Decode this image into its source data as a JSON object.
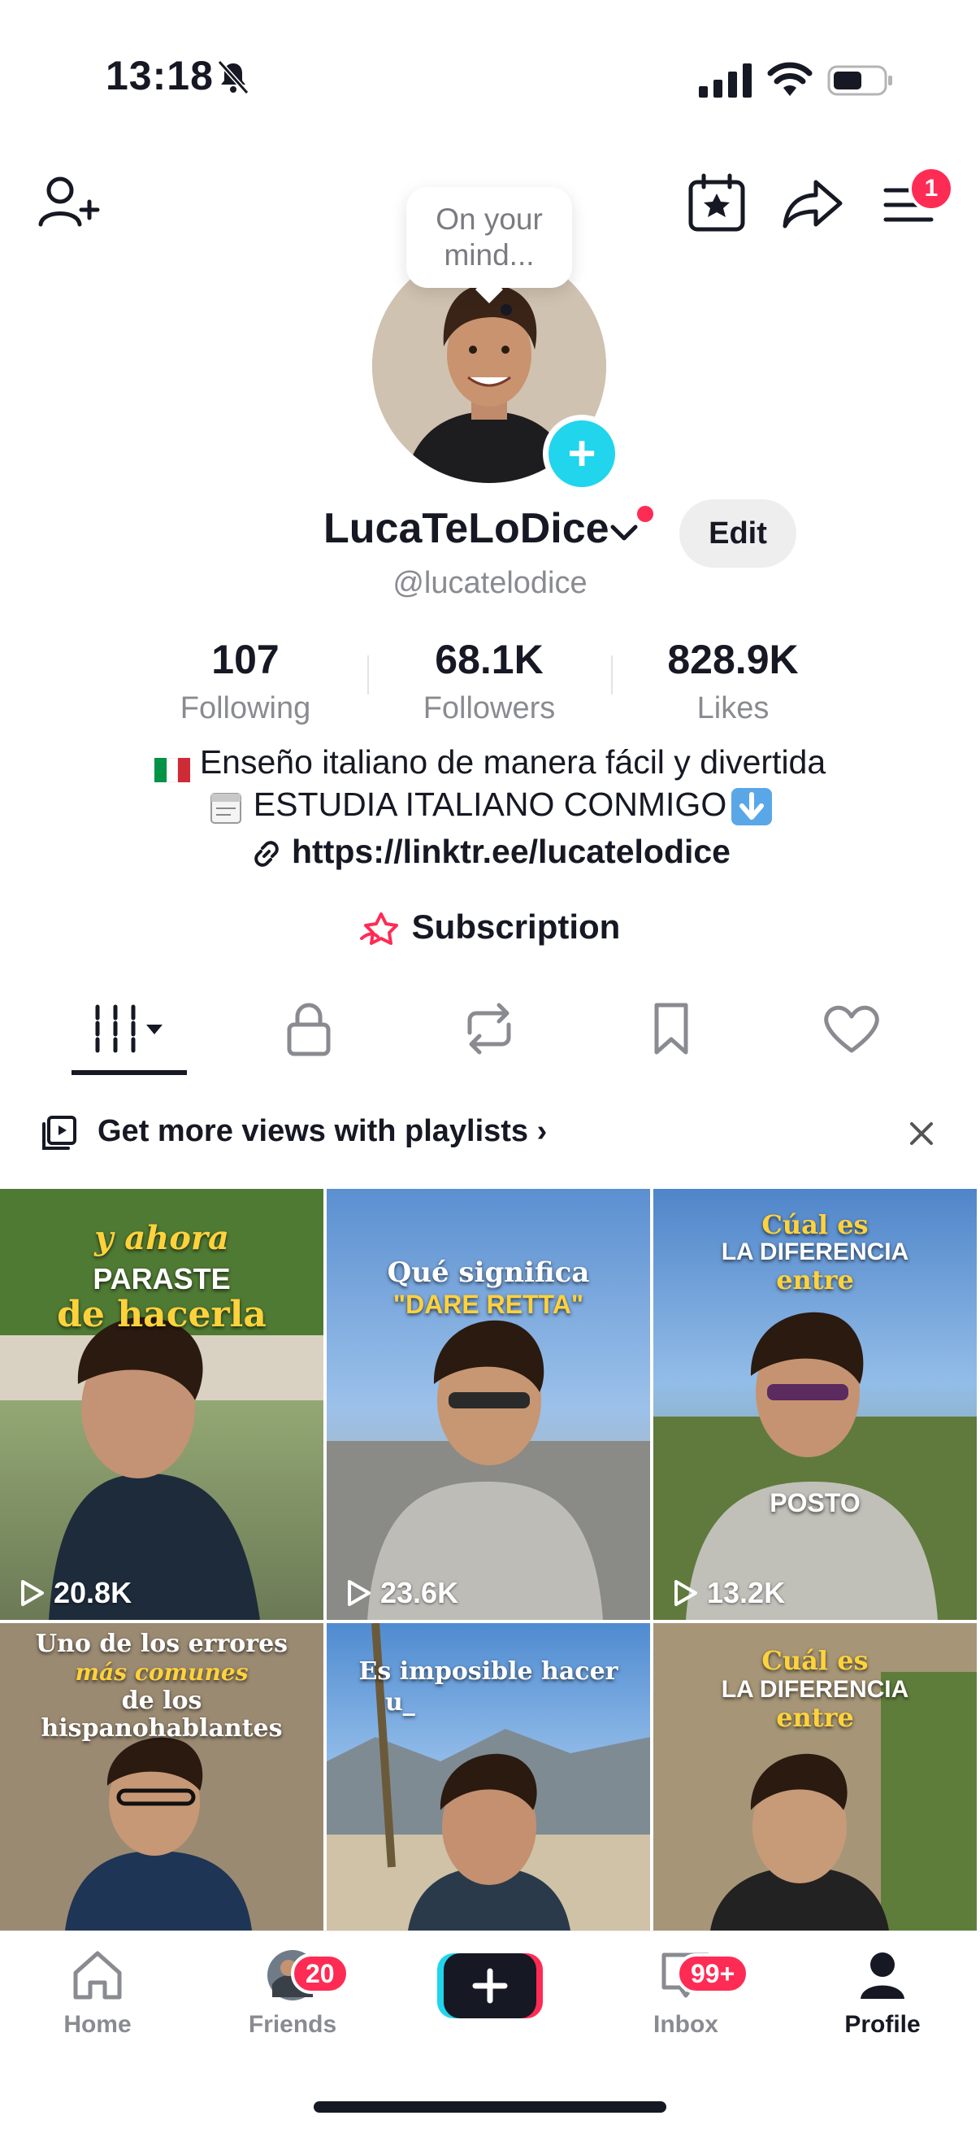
{
  "status_bar": {
    "time": "13:18"
  },
  "header": {
    "menu_badge": "1"
  },
  "avatar_bubble": {
    "text_line1": "On your",
    "text_line2": "mind..."
  },
  "profile": {
    "display_name": "LucaTeLoDice",
    "edit_label": "Edit",
    "handle": "@lucatelodice"
  },
  "stats": [
    {
      "value": "107",
      "label": "Following"
    },
    {
      "value": "68.1K",
      "label": "Followers"
    },
    {
      "value": "828.9K",
      "label": "Likes"
    }
  ],
  "bio": {
    "line1": "Enseño italiano de manera fácil y divertida",
    "line2": "ESTUDIA ITALIANO CONMIGO",
    "link": "https://linktr.ee/lucatelodice",
    "subscription": "Subscription"
  },
  "playlist_banner": {
    "text": "Get more views with playlists"
  },
  "videos": [
    {
      "caption_a": "y ahora",
      "caption_b": "PARASTE",
      "caption_c": "de hacerla",
      "views": "20.8K"
    },
    {
      "caption_a": "Qué significa",
      "caption_b": "\"DARE RETTA\"",
      "caption_c": "",
      "views": "23.6K"
    },
    {
      "caption_a": "Cúal es",
      "caption_b": "LA DIFERENCIA",
      "caption_c": "entre",
      "caption_d": "POSTO",
      "views": "13.2K"
    },
    {
      "caption_a": "Uno de los errores",
      "caption_b": "más comunes",
      "caption_c": "de los",
      "caption_d": "hispanohablantes"
    },
    {
      "caption_a": "Es imposible hacer",
      "caption_b": "u_"
    },
    {
      "caption_a": "Cuál es",
      "caption_b": "LA DIFERENCIA",
      "caption_c": "entre"
    }
  ],
  "nav": {
    "home": "Home",
    "friends": "Friends",
    "friends_badge": "20",
    "inbox": "Inbox",
    "inbox_badge": "99+",
    "profile": "Profile"
  },
  "colors": {
    "accent": "#fe2c55",
    "cyan": "#20d5ec",
    "text": "#161823",
    "muted": "#8a8b91"
  }
}
